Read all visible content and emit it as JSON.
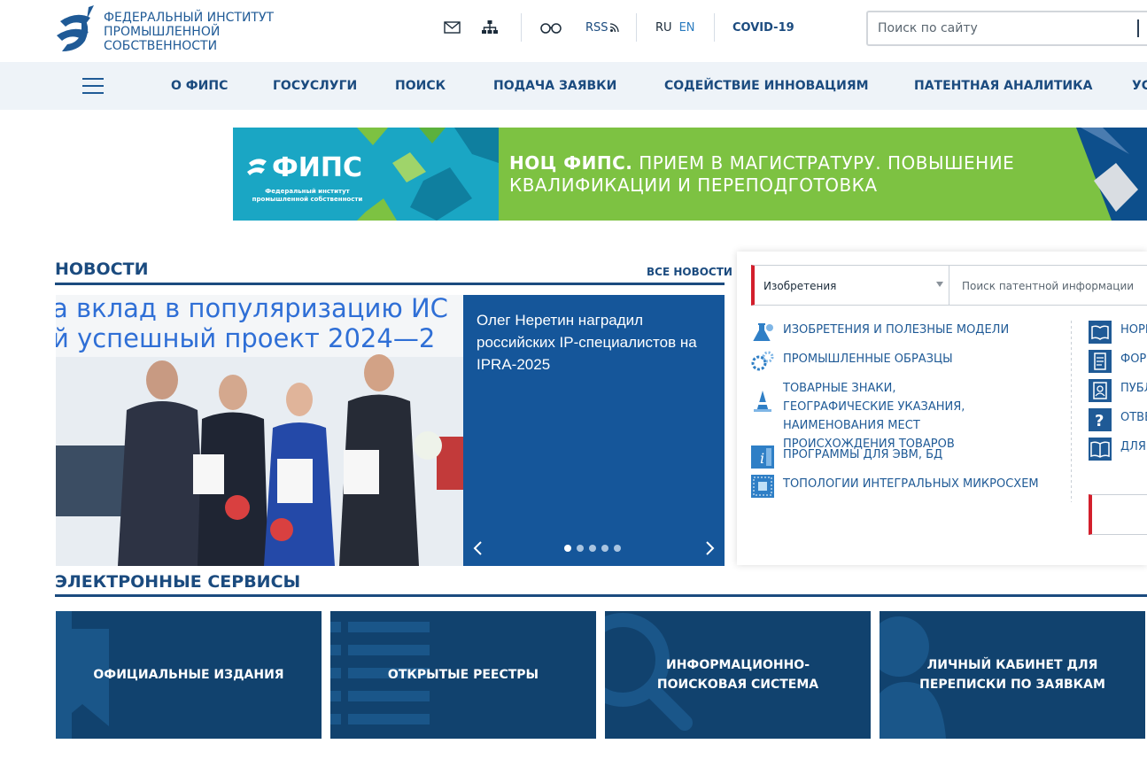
{
  "header": {
    "logo_text": "ФЕДЕРАЛЬНЫЙ ИНСТИТУТ ПРОМЫШЛЕННОЙ СОБСТВЕННОСТИ",
    "rss_label": "RSS",
    "lang_ru": "RU",
    "lang_en": "EN",
    "covid_label": "COVID-19",
    "search_placeholder": "Поиск по сайту"
  },
  "nav": {
    "items": [
      "О ФИПС",
      "ГОСУСЛУГИ",
      "ПОИСК",
      "ПОДАЧА ЗАЯВКИ",
      "СОДЕЙСТВИЕ ИННОВАЦИЯМ",
      "ПАТЕНТНАЯ АНАЛИТИКА",
      "УС"
    ]
  },
  "banner": {
    "logo_big": "ФИПС",
    "logo_small": "Федеральный институт промышленной собственности",
    "text_bold": "НОЦ ФИПС.",
    "text_rest": " ПРИЕМ В МАГИСТРАТУРУ. ПОВЫШЕНИЕ КВАЛИФИКАЦИИ И ПЕРЕПОДГОТОВКА"
  },
  "news": {
    "title": "НОВОСТИ",
    "all_news": "ВСЕ НОВОСТИ",
    "photo_line1": "а вклад в популяризацию ИС",
    "photo_line2": "й успешный проект 2024—2",
    "card_title": "Олег Неретин наградил российских IP-специалистов на IPRA-2025",
    "dots_count": 5,
    "active_dot": 1
  },
  "patent_search": {
    "select_value": "Изобретения",
    "input_placeholder": "Поиск патентной информации",
    "categories": [
      "ИЗОБРЕТЕНИЯ И ПОЛЕЗНЫЕ МОДЕЛИ",
      "ПРОМЫШЛЕННЫЕ ОБРАЗЦЫ",
      "ТОВАРНЫЕ ЗНАКИ, ГЕОГРАФИЧЕСКИЕ УКАЗАНИЯ, НАИМЕНОВАНИЯ МЕСТ ПРОИСХОЖДЕНИЯ ТОВАРОВ",
      "ПРОГРАММЫ ДЛЯ ЭВМ, БД",
      "ТОПОЛОГИИ ИНТЕГРАЛЬНЫХ МИКРОСХЕМ"
    ],
    "right_items": [
      "НОРМ",
      "ФОРМ",
      "ПУБЛ",
      "ОТВЕ",
      "ДЛЯ"
    ]
  },
  "services": {
    "title": "ЭЛЕКТРОННЫЕ СЕРВИСЫ",
    "tiles": [
      "ОФИЦИАЛЬНЫЕ ИЗДАНИЯ",
      "ОТКРЫТЫЕ РЕЕСТРЫ",
      "ИНФОРМАЦИОННО-ПОИСКОВАЯ СИСТЕМА",
      "ЛИЧНЫЙ КАБИНЕТ ДЛЯ ПЕРЕПИСКИ ПО ЗАЯВКАМ"
    ]
  },
  "colors": {
    "brand_blue": "#1b4b7f",
    "news_card": "#15569a",
    "tile_bg": "#11426e",
    "accent_red": "#d31f2c",
    "banner_green": "#7dc242",
    "banner_teal": "#1aa6c4"
  }
}
